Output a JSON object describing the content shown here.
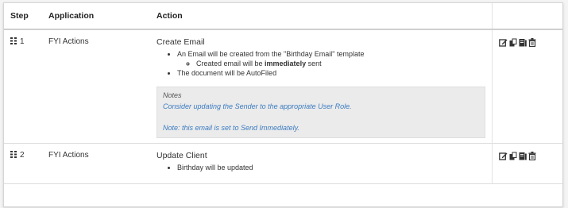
{
  "table": {
    "headers": {
      "step": "Step",
      "application": "Application",
      "action": "Action"
    },
    "rows": [
      {
        "step": "1",
        "application": "FYI Actions",
        "action_title": "Create Email",
        "bullet_1": "An Email will be created from the \"Birthday Email\" template",
        "sub_before": "Created email will be ",
        "sub_bold": "immediately",
        "sub_after": " sent",
        "bullet_2": "The document will be AutoFiled",
        "notes_heading": "Notes",
        "notes_line_1": "Consider updating the Sender to the appropriate User Role.",
        "notes_line_2": "Note: this email is set to Send Immediately."
      },
      {
        "step": "2",
        "application": "FYI Actions",
        "action_title": "Update Client",
        "bullet_1": "Birthday will be updated"
      }
    ]
  },
  "icons": [
    "edit-icon",
    "copy-icon",
    "template-icon",
    "delete-icon"
  ],
  "colors": {
    "notes_text": "#3b7bc0",
    "notes_bg": "#ebebeb"
  }
}
